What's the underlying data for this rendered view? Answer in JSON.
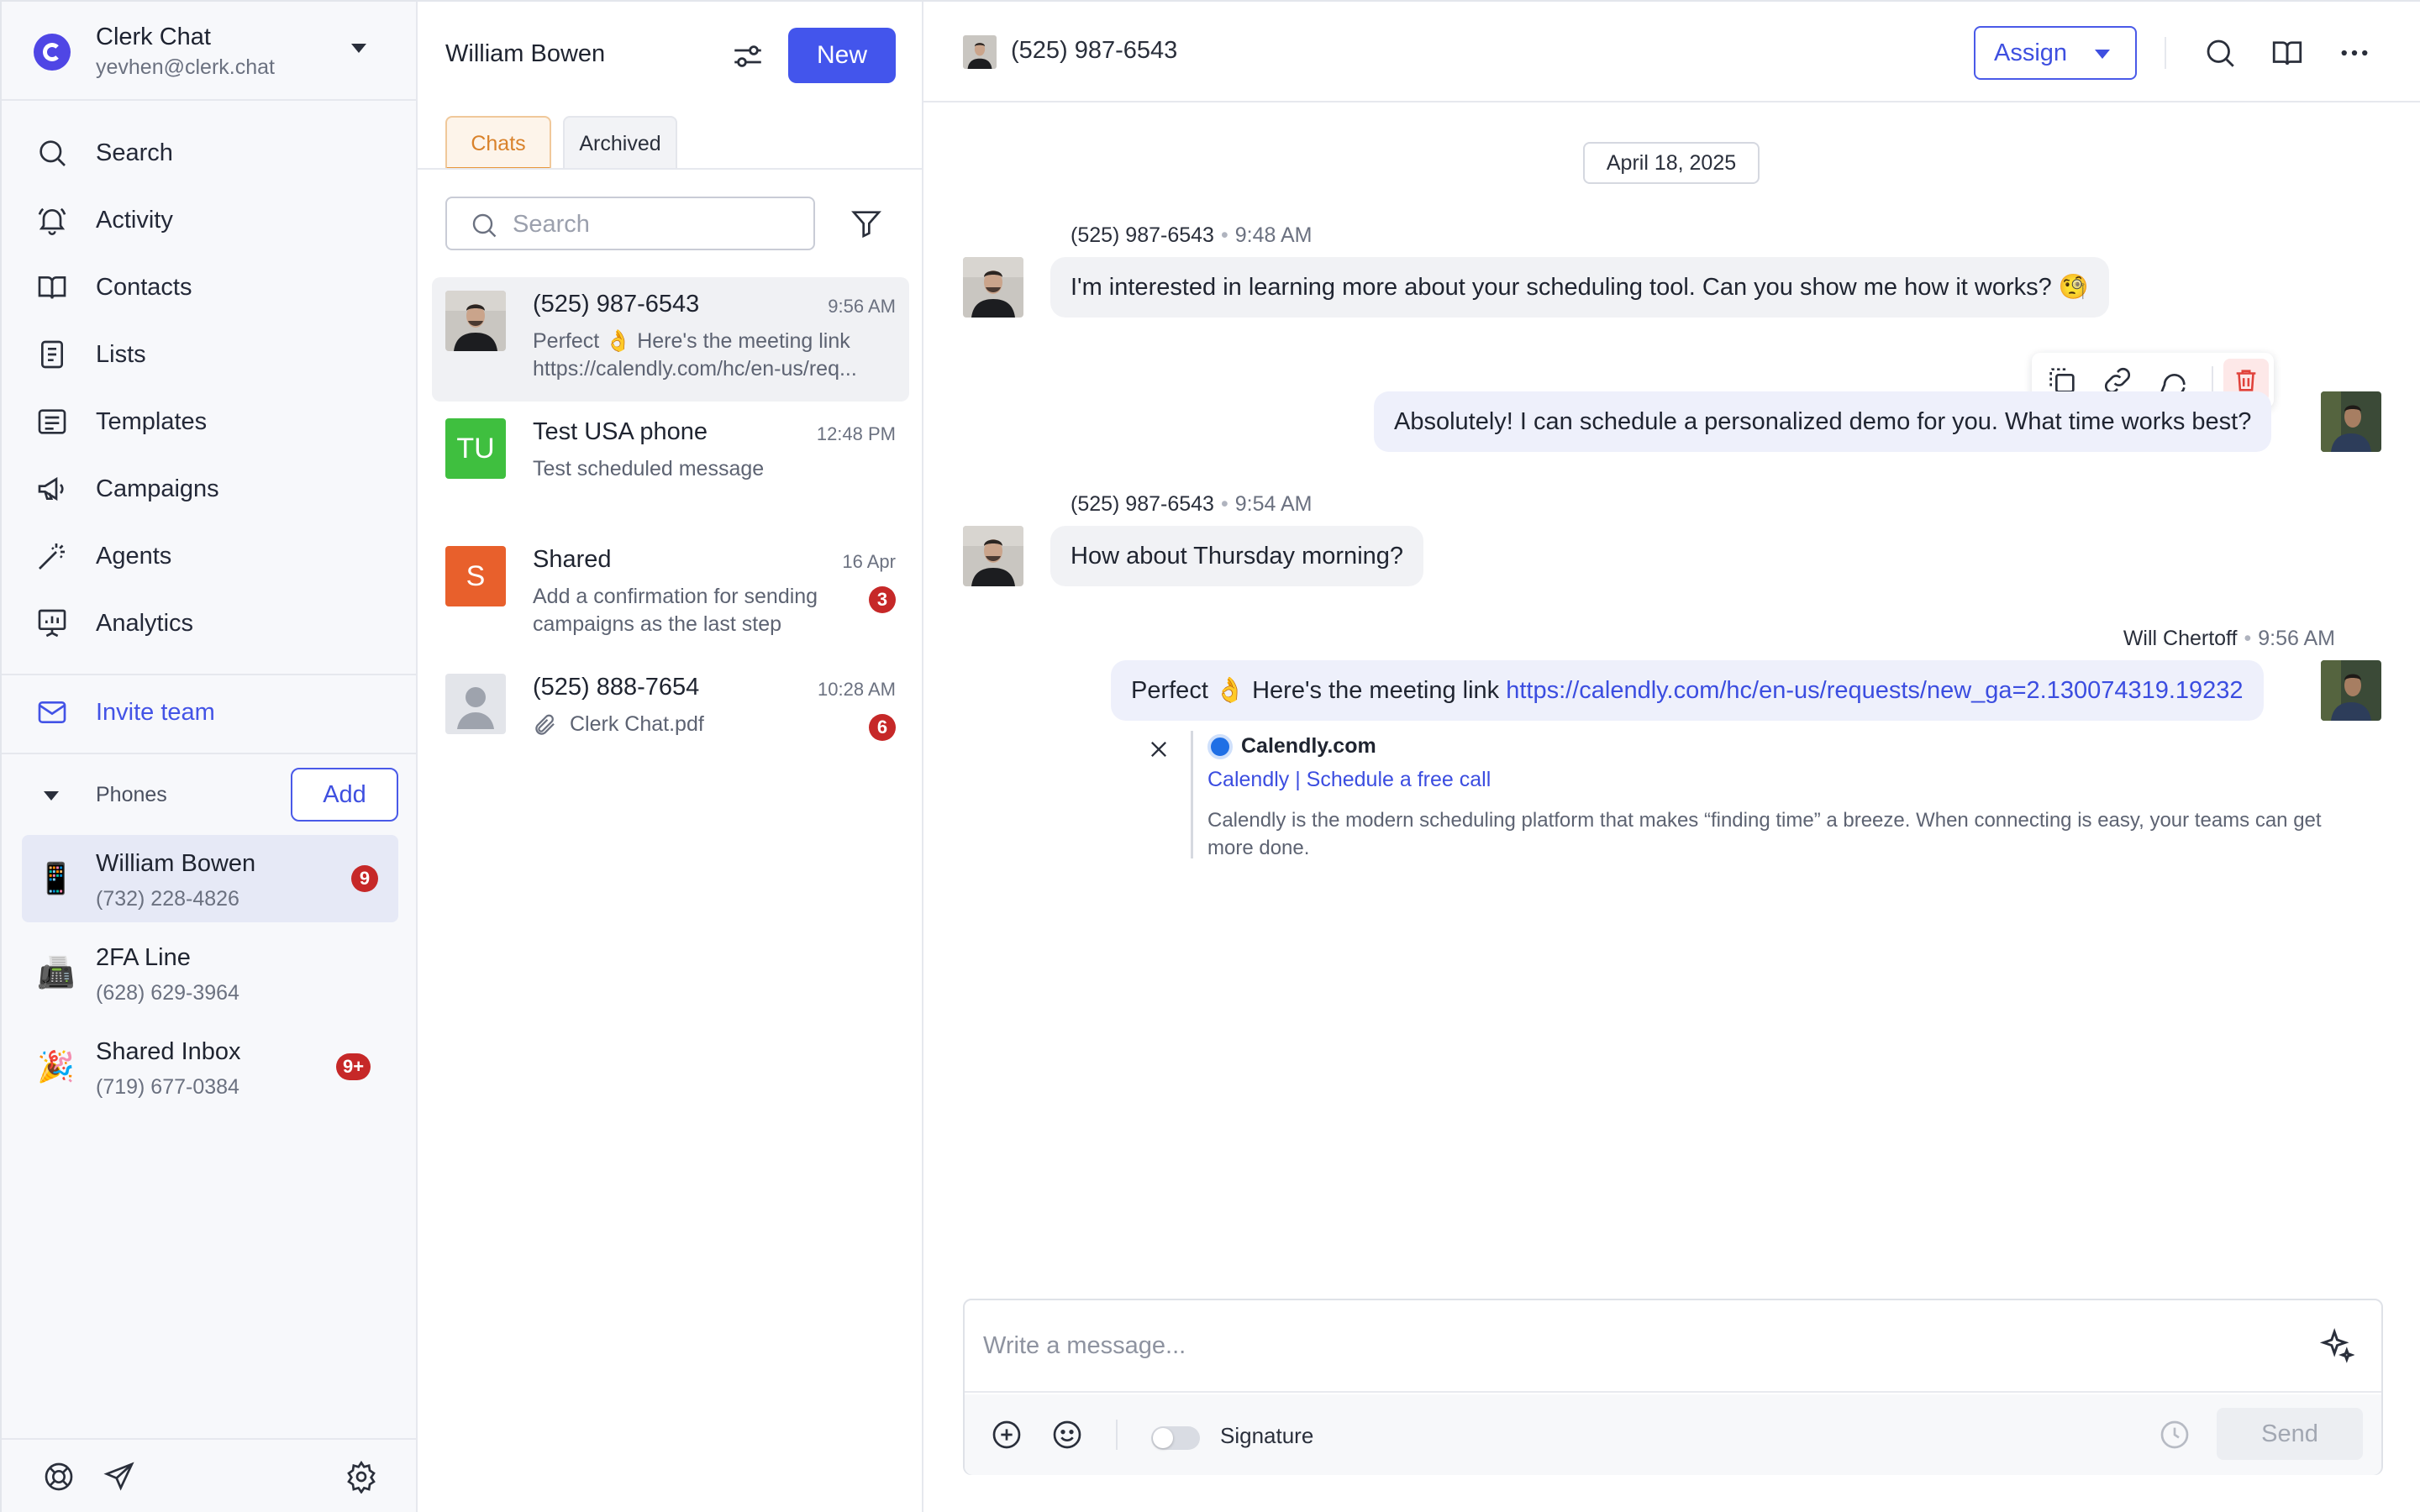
{
  "org": {
    "name": "Clerk Chat",
    "email": "yevhen@clerk.chat"
  },
  "nav": [
    {
      "label": "Search",
      "icon": "search-icon"
    },
    {
      "label": "Activity",
      "icon": "bell-icon"
    },
    {
      "label": "Contacts",
      "icon": "book-icon"
    },
    {
      "label": "Lists",
      "icon": "list-icon"
    },
    {
      "label": "Templates",
      "icon": "templates-icon"
    },
    {
      "label": "Campaigns",
      "icon": "megaphone-icon"
    },
    {
      "label": "Agents",
      "icon": "magic-wand-icon"
    },
    {
      "label": "Analytics",
      "icon": "presentation-chart-icon"
    }
  ],
  "invite": {
    "label": "Invite team"
  },
  "phones": {
    "title": "Phones",
    "add_label": "Add",
    "items": [
      {
        "name": "William Bowen",
        "number": "(732) 228-4826",
        "badge": "9",
        "emoji": "📱"
      },
      {
        "name": "2FA Line",
        "number": "(628) 629-3964",
        "badge": "",
        "emoji": "📠"
      },
      {
        "name": "Shared Inbox",
        "number": "(719) 677-0384",
        "badge": "9+",
        "emoji": "🎉"
      }
    ]
  },
  "chatlist": {
    "title": "William Bowen",
    "new_label": "New",
    "tabs": {
      "chats": "Chats",
      "archived": "Archived"
    },
    "search_placeholder": "Search",
    "conversations": [
      {
        "name": "(525) 987-6543",
        "time": "9:56 AM",
        "preview": "Perfect 👌 Here's the meeting link",
        "preview2": "https://calendly.com/hc/en-us/req...",
        "badge": ""
      },
      {
        "name": "Test USA phone",
        "time": "12:48 PM",
        "preview": "Test scheduled message",
        "badge": "",
        "initials": "TU",
        "color": "#3fbf3f"
      },
      {
        "name": "Shared",
        "time": "16 Apr",
        "preview": "Add a confirmation for sending campaigns as the last step",
        "badge": "3",
        "initials": "S",
        "color": "#e8602c"
      },
      {
        "name": "(525) 888-7654",
        "time": "10:28 AM",
        "preview": "Clerk Chat.pdf",
        "badge": "6"
      }
    ]
  },
  "conversation": {
    "title": "(525) 987-6543",
    "assign_label": "Assign",
    "date": "April 18, 2025",
    "messages": [
      {
        "sender": "(525) 987-6543",
        "time": "9:48 AM",
        "text": "I'm interested in learning more about your scheduling tool. Can you show me how it works? 🧐"
      },
      {
        "text": "Absolutely! I can schedule a personalized demo for you. What time works best?"
      },
      {
        "sender": "(525) 987-6543",
        "time": "9:54 AM",
        "text": "How about Thursday morning?"
      },
      {
        "sender": "Will Chertoff",
        "time": "9:56 AM",
        "text": "Perfect 👌 Here's the meeting link ",
        "link": "https://calendly.com/hc/en-us/requests/new_ga=2.130074319.19232"
      }
    ],
    "link_preview": {
      "site": "Calendly.com",
      "title": "Calendly | Schedule a free call",
      "description": "Calendly is the modern scheduling platform that makes “finding time” a breeze. When connecting is easy, your teams can get more done."
    }
  },
  "composer": {
    "placeholder": "Write a message...",
    "signature_label": "Signature",
    "send_label": "Send"
  },
  "colors": {
    "accent": "#4355ec",
    "tab_active": "#d9822b",
    "badge": "#c62828",
    "link": "#3b4de0"
  }
}
